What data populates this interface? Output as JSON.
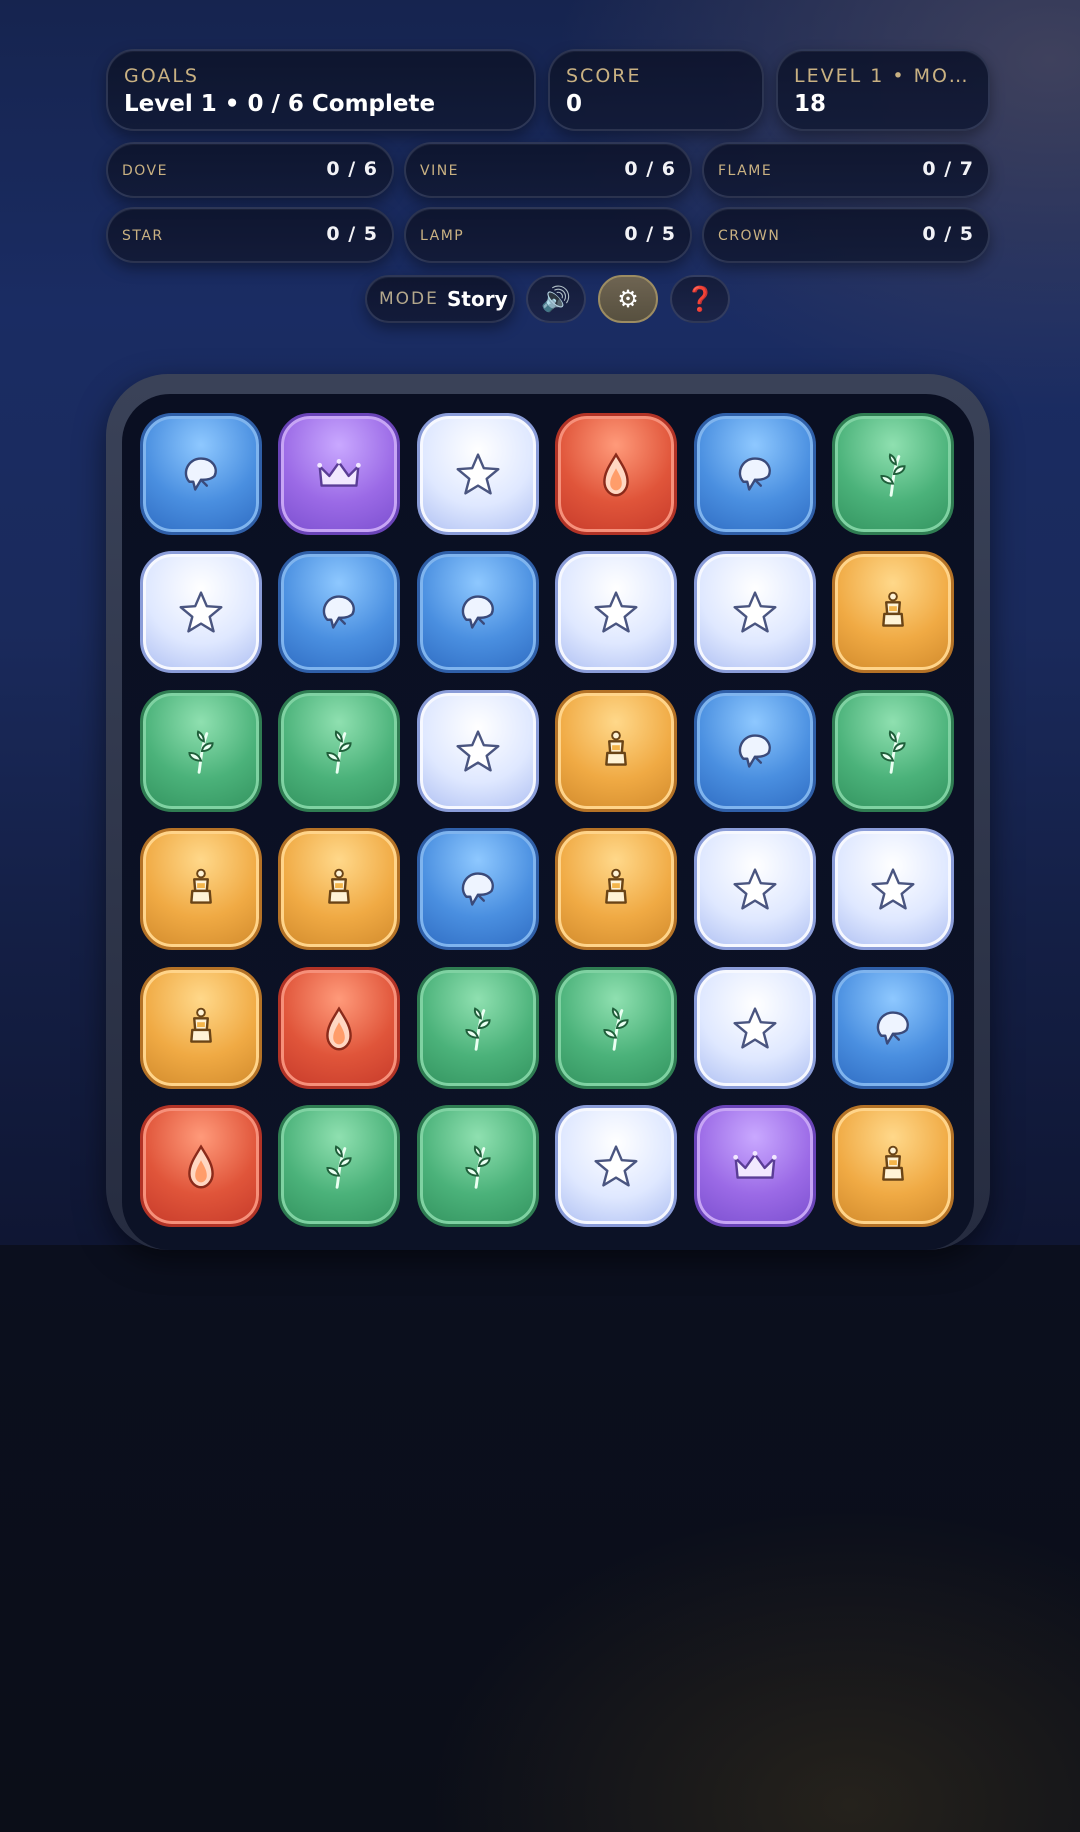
{
  "hud": {
    "goals": {
      "label": "GOALS",
      "value": "Level 1 • 0 / 6 Complete"
    },
    "score": {
      "label": "SCORE",
      "value": "0"
    },
    "level": {
      "label": "LEVEL 1 • MOV…",
      "value": "18"
    }
  },
  "goals": [
    {
      "label": "DOVE",
      "value": "0 / 6"
    },
    {
      "label": "VINE",
      "value": "0 / 6"
    },
    {
      "label": "FLAME",
      "value": "0 / 7"
    },
    {
      "label": "STAR",
      "value": "0 / 5"
    },
    {
      "label": "LAMP",
      "value": "0 / 5"
    },
    {
      "label": "CROWN",
      "value": "0 / 5"
    }
  ],
  "controls": {
    "mode_label": "MODE",
    "mode_value": "Story",
    "buttons": [
      {
        "icon": "speaker-icon",
        "glyph": "🔊",
        "active": false
      },
      {
        "icon": "gear-icon",
        "glyph": "⚙",
        "active": true
      },
      {
        "icon": "help-icon",
        "glyph": "❓",
        "active": false
      }
    ]
  },
  "board": {
    "rows": 6,
    "cols": 6,
    "grid": [
      [
        "dove",
        "crown",
        "star",
        "flame",
        "dove",
        "vine"
      ],
      [
        "star",
        "dove",
        "dove",
        "star",
        "star",
        "lamp"
      ],
      [
        "vine",
        "vine",
        "star",
        "lamp",
        "dove",
        "vine"
      ],
      [
        "lamp",
        "lamp",
        "dove",
        "lamp",
        "star",
        "star"
      ],
      [
        "lamp",
        "flame",
        "vine",
        "vine",
        "star",
        "dove"
      ],
      [
        "flame",
        "vine",
        "vine",
        "star",
        "crown",
        "lamp"
      ]
    ]
  }
}
